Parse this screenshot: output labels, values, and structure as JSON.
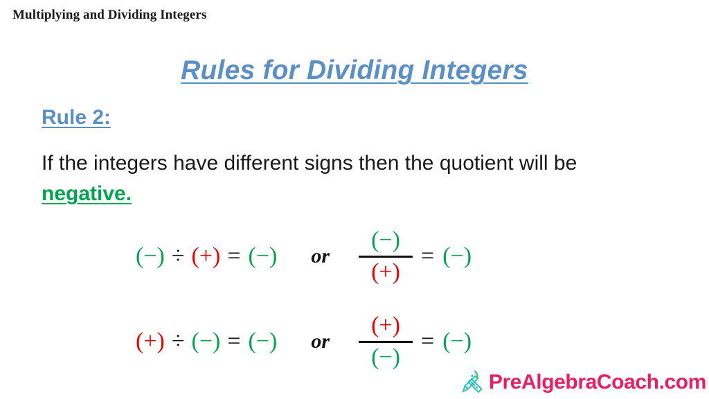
{
  "header": {
    "title": "Multiplying and Dividing Integers"
  },
  "title": {
    "text": "Rules for Dividing Integers"
  },
  "rule": {
    "label": "Rule 2:",
    "body_before": "If the integers have different signs then the quotient will be ",
    "emphasis": "negative.",
    "body_after": ""
  },
  "colors": {
    "title_blue": "#5b8fc7",
    "negative_green": "#00a550",
    "positive_red": "#ee0000",
    "text_black": "#1a1a1a",
    "brand_pink": "#ec1e63",
    "brand_teal": "#2ec4b6"
  },
  "equations": [
    {
      "inline": {
        "left": "(−)",
        "left_sign": "neg",
        "operator": "÷",
        "right": "(+)",
        "right_sign": "pos",
        "equals": "=",
        "result": "(−)",
        "result_sign": "neg"
      },
      "connector": "or",
      "fraction": {
        "numerator": "(−)",
        "numerator_sign": "neg",
        "denominator": "(+)",
        "denominator_sign": "pos",
        "equals": "=",
        "result": "(−)",
        "result_sign": "neg"
      }
    },
    {
      "inline": {
        "left": "(+)",
        "left_sign": "pos",
        "operator": "÷",
        "right": "(−)",
        "right_sign": "neg",
        "equals": "=",
        "result": "(−)",
        "result_sign": "neg"
      },
      "connector": "or",
      "fraction": {
        "numerator": "(+)",
        "numerator_sign": "pos",
        "denominator": "(−)",
        "denominator_sign": "neg",
        "equals": "=",
        "result": "(−)",
        "result_sign": "neg"
      }
    }
  ],
  "branding": {
    "icon": "pencil-ruler-icon",
    "text": "PreAlgebraCoach.com"
  }
}
